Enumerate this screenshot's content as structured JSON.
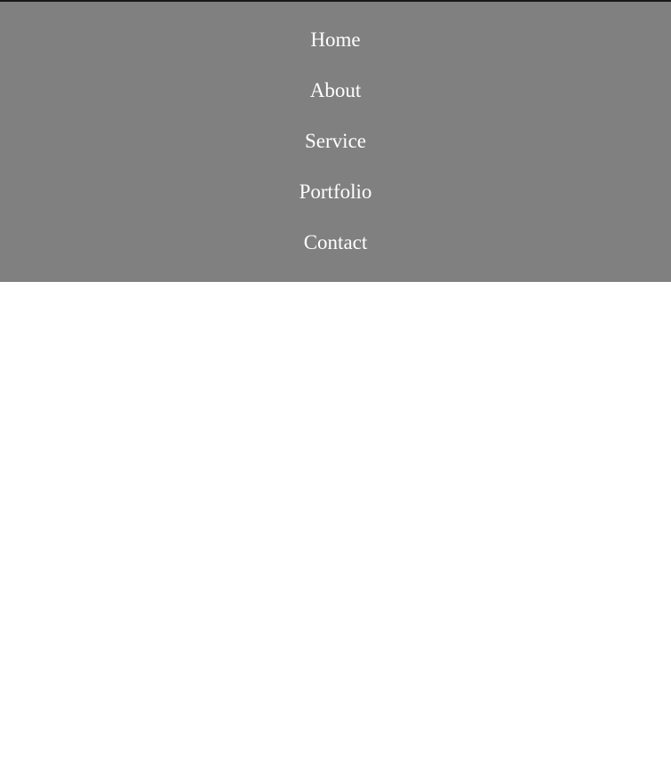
{
  "nav": {
    "items": [
      {
        "label": "Home"
      },
      {
        "label": "About"
      },
      {
        "label": "Service"
      },
      {
        "label": "Portfolio"
      },
      {
        "label": "Contact"
      }
    ]
  },
  "colors": {
    "nav_background": "#808080",
    "nav_text": "#ffffff",
    "top_border": "#1a1a1a",
    "page_background": "#ffffff"
  }
}
